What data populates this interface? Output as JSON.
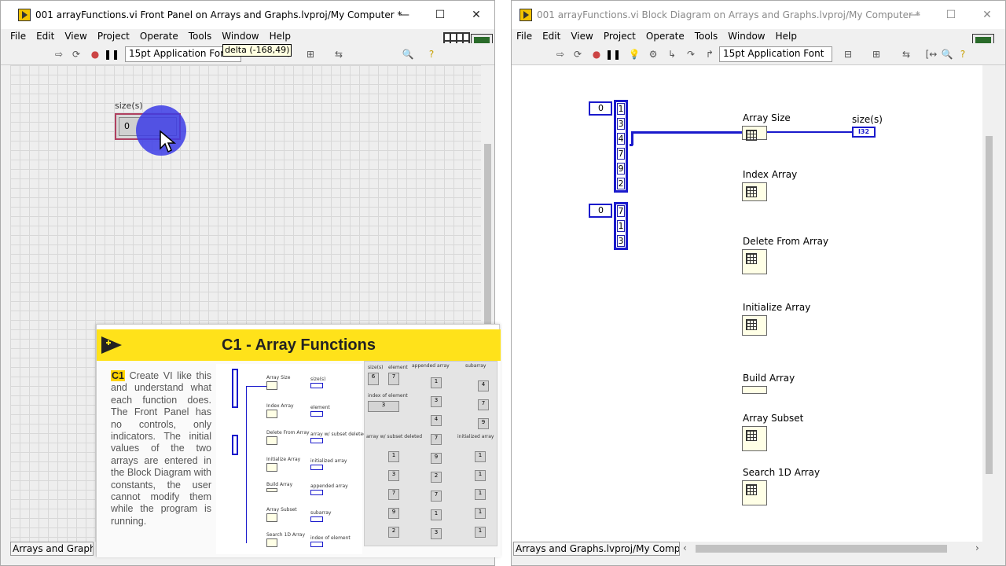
{
  "front_panel": {
    "title": "001 arrayFunctions.vi Front Panel on Arrays and Graphs.lvproj/My Computer *",
    "menu": [
      "File",
      "Edit",
      "View",
      "Project",
      "Operate",
      "Tools",
      "Window",
      "Help"
    ],
    "font": "15pt Application Font",
    "tooltip": "delta (-168,49)",
    "indicator_label": "size(s)",
    "indicator_value": "0",
    "status": "Arrays and Graphs.l"
  },
  "block_diagram": {
    "title": "001 arrayFunctions.vi Block Diagram on Arrays and Graphs.lvproj/My Computer *",
    "menu": [
      "File",
      "Edit",
      "View",
      "Project",
      "Operate",
      "Tools",
      "Window",
      "Help"
    ],
    "font": "15pt Application Font",
    "array1": {
      "index": "0",
      "values": [
        "1",
        "3",
        "4",
        "7",
        "9",
        "2"
      ]
    },
    "array2": {
      "index": "0",
      "values": [
        "7",
        "1",
        "3"
      ]
    },
    "functions": [
      "Array Size",
      "Index Array",
      "Delete From Array",
      "Initialize Array",
      "Build Array",
      "Array Subset",
      "Search 1D Array"
    ],
    "output_label": "size(s)",
    "output_type": "I32",
    "status": "Arrays and Graphs.lvproj/My Computer"
  },
  "slide": {
    "title": "C1 - Array Functions",
    "tag": "C1",
    "text": "Create VI like this and understand what each function does. The Front Panel has no controls, only indicators. The initial values of the two arrays are entered in the Block Diagram with constants, the user cannot modify them while the program is running."
  },
  "mini_bd": {
    "functions": [
      "Array Size",
      "Index Array",
      "Delete From Array",
      "Initialize Array",
      "Build Array",
      "Array Subset",
      "Search 1D Array"
    ],
    "outputs": [
      "size(s)",
      "element",
      "array w/ subset deleted",
      "initialized array",
      "appended array",
      "subarray",
      "index of element"
    ]
  },
  "mini_fp": {
    "labels": [
      "size(s)",
      "element",
      "appended array",
      "subarray",
      "index of element",
      "array w/ subset deleted",
      "initialized array"
    ],
    "size_value": "6",
    "element_value": "7",
    "index_value": "3",
    "appended": [
      "1",
      "3",
      "4",
      "7",
      "9",
      "2",
      "7",
      "1",
      "3"
    ],
    "subarray": [
      "4",
      "7",
      "9"
    ],
    "deleted": [
      "1",
      "3",
      "7",
      "9",
      "2"
    ],
    "initialized": [
      "1",
      "1",
      "1",
      "1",
      "1"
    ]
  }
}
